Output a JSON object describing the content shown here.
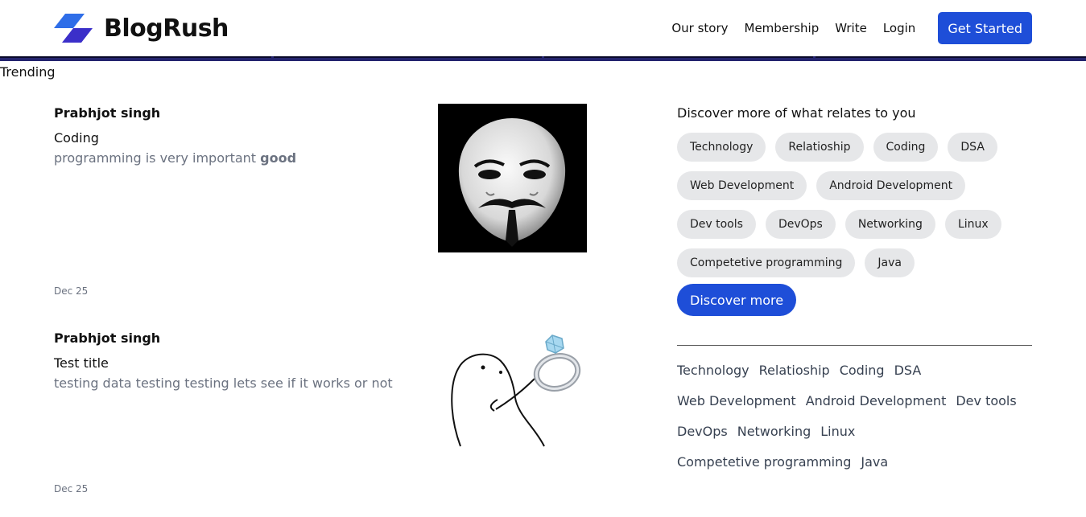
{
  "brand": {
    "name": "BlogRush",
    "primary_color": "#1e4ed8"
  },
  "nav": {
    "links": [
      "Our story",
      "Membership",
      "Write",
      "Login"
    ],
    "cta": "Get Started"
  },
  "section_heading": "Trending",
  "posts": [
    {
      "author": "Prabhjot singh",
      "title": "Coding",
      "excerpt": "programming is very important",
      "excerpt_bold": "good",
      "date": "Dec 25",
      "thumbnail": "guy-fawkes-mask-image"
    },
    {
      "author": "Prabhjot singh",
      "title": "Test title",
      "excerpt": "testing data testing testing lets see if it works or not",
      "excerpt_bold": "",
      "date": "Dec 25",
      "thumbnail": "cartoon-ring-proposal-image"
    }
  ],
  "sidebar": {
    "title": "Discover more of what relates to you",
    "topics": [
      "Technology",
      "Relatioship",
      "Coding",
      "DSA",
      "Web Development",
      "Android Development",
      "Dev tools",
      "DevOps",
      "Networking",
      "Linux",
      "Competetive programming",
      "Java"
    ],
    "discover_button": "Discover more",
    "tag_links": [
      "Technology",
      "Relatioship",
      "Coding",
      "DSA",
      "Web Development",
      "Android Development",
      "Dev tools",
      "DevOps",
      "Networking",
      "Linux",
      "Competetive programming",
      "Java"
    ]
  }
}
